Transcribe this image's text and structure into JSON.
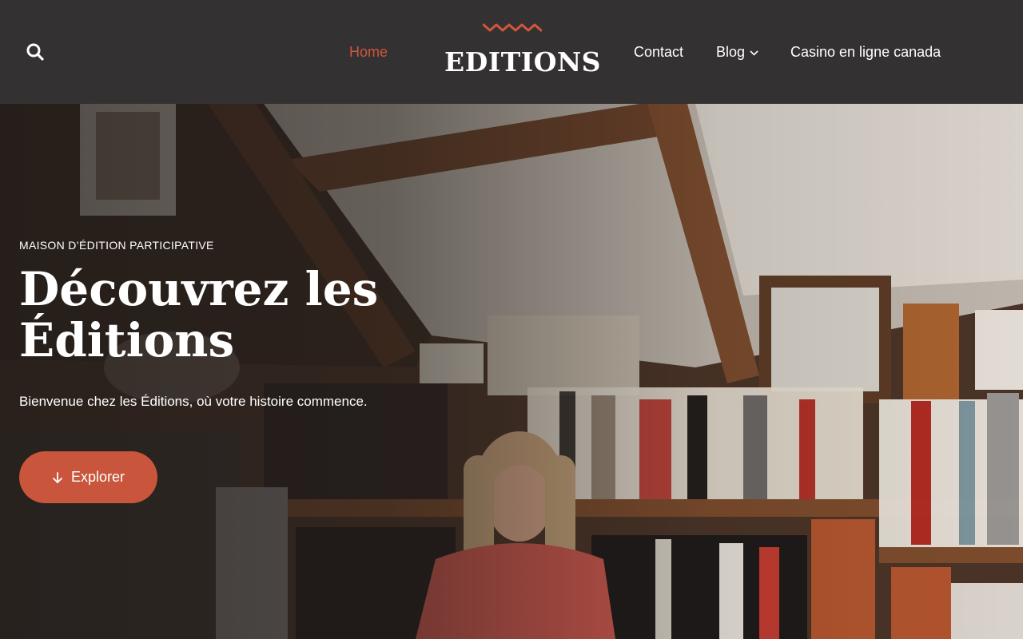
{
  "header": {
    "search_icon": "search-icon",
    "logo": {
      "text": "EDITIONS",
      "wave_icon": "zigzag-wave-icon"
    },
    "nav": {
      "home": "Home",
      "contact": "Contact",
      "blog": "Blog",
      "casino": "Casino en ligne canada"
    }
  },
  "hero": {
    "eyebrow": "MAISON D’ÉDITION PARTICIPATIVE",
    "title": "Découvrez les Éditions",
    "subtitle": "Bienvenue chez les Éditions, où votre histoire commence.",
    "cta": {
      "label": "Explorer",
      "icon": "arrow-down-icon"
    },
    "image": "woman-reading-in-attic-library-photo"
  },
  "colors": {
    "header_bg": "#333132",
    "accent": "#d0573b",
    "button_bg": "#c9553c",
    "text": "#ffffff"
  }
}
